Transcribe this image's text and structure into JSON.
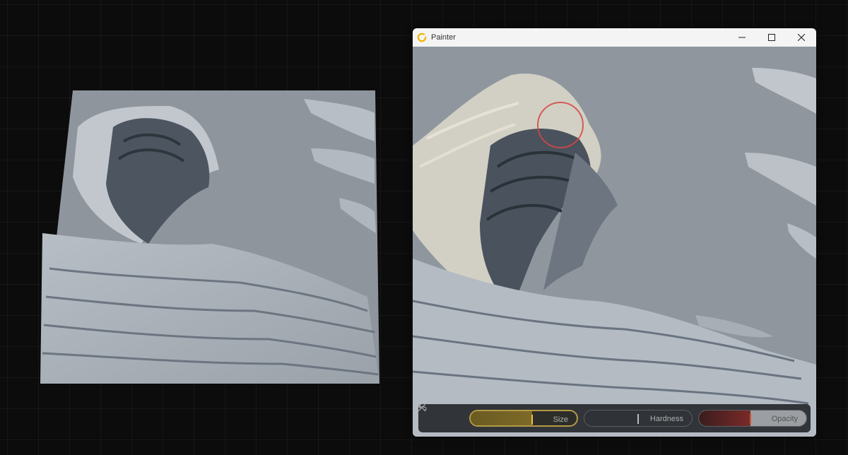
{
  "window": {
    "title": "Painter",
    "minimize_icon": "minimize-icon",
    "maximize_icon": "maximize-icon",
    "close_icon": "close-icon"
  },
  "toolbar": {
    "close_icon": "close-icon",
    "undo_icon": "undo-icon",
    "size_label": "Size",
    "size_value": 0.58,
    "hardness_label": "Hardness",
    "hardness_value": 0.5,
    "opacity_label": "Opacity",
    "opacity_value": 0.48
  },
  "colors": {
    "accent": "#e7c24a",
    "brush_cursor": "#d64646",
    "terrain_base": "#8f969e"
  }
}
